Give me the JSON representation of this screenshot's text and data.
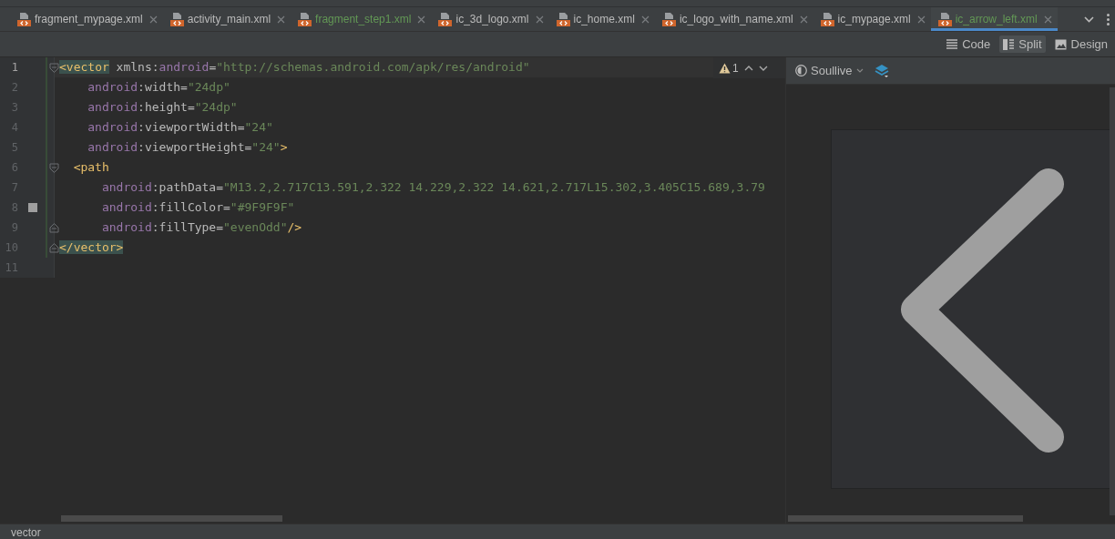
{
  "tabs": [
    {
      "label": "fragment_mypage.xml",
      "selected": false,
      "added": false
    },
    {
      "label": "activity_main.xml",
      "selected": false,
      "added": false
    },
    {
      "label": "fragment_step1.xml",
      "selected": false,
      "added": true
    },
    {
      "label": "ic_3d_logo.xml",
      "selected": false,
      "added": false
    },
    {
      "label": "ic_home.xml",
      "selected": false,
      "added": false
    },
    {
      "label": "ic_logo_with_name.xml",
      "selected": false,
      "added": false
    },
    {
      "label": "ic_mypage.xml",
      "selected": false,
      "added": false
    },
    {
      "label": "ic_arrow_left.xml",
      "selected": true,
      "added": true
    }
  ],
  "view_modes": [
    {
      "label": "Code",
      "kind": "code",
      "selected": false
    },
    {
      "label": "Split",
      "kind": "split",
      "selected": true
    },
    {
      "label": "Design",
      "kind": "design",
      "selected": false
    }
  ],
  "editor": {
    "warnings": {
      "count": "1"
    },
    "lines": [
      {
        "number": "1",
        "kind": "element",
        "current": true,
        "fold_start": true,
        "fold_end": false,
        "tokens": [
          {
            "kind": "tag",
            "text": "<vector",
            "matched": true
          },
          {
            "kind": "plain",
            "text": " xmlns:"
          },
          {
            "kind": "ns",
            "text": "android"
          },
          {
            "kind": "plain",
            "text": "="
          },
          {
            "kind": "value",
            "text": "\"http://schemas.android.com/apk/res/android\""
          }
        ]
      },
      {
        "number": "2",
        "kind": "attribute",
        "current": false,
        "fold_start": false,
        "fold_end": false,
        "tokens": [
          {
            "kind": "ns",
            "text": "android"
          },
          {
            "kind": "plain",
            "text": ":width="
          },
          {
            "kind": "value",
            "text": "\"24dp\""
          }
        ]
      },
      {
        "number": "3",
        "kind": "attribute",
        "current": false,
        "fold_start": false,
        "fold_end": false,
        "tokens": [
          {
            "kind": "ns",
            "text": "android"
          },
          {
            "kind": "plain",
            "text": ":height="
          },
          {
            "kind": "value",
            "text": "\"24dp\""
          }
        ]
      },
      {
        "number": "4",
        "kind": "attribute",
        "current": false,
        "fold_start": false,
        "fold_end": false,
        "tokens": [
          {
            "kind": "ns",
            "text": "android"
          },
          {
            "kind": "plain",
            "text": ":viewportWidth="
          },
          {
            "kind": "value",
            "text": "\"24\""
          }
        ]
      },
      {
        "number": "5",
        "kind": "attribute",
        "current": false,
        "fold_start": false,
        "fold_end": false,
        "tokens": [
          {
            "kind": "ns",
            "text": "android"
          },
          {
            "kind": "plain",
            "text": ":viewportHeight="
          },
          {
            "kind": "value",
            "text": "\"24\""
          },
          {
            "kind": "tag",
            "text": ">"
          }
        ]
      },
      {
        "number": "6",
        "kind": "child_element",
        "current": false,
        "fold_start": true,
        "fold_end": false,
        "tokens": [
          {
            "kind": "tag",
            "text": "<path"
          }
        ]
      },
      {
        "number": "7",
        "kind": "child_attribute",
        "current": false,
        "fold_start": false,
        "fold_end": false,
        "tokens": [
          {
            "kind": "ns",
            "text": "android"
          },
          {
            "kind": "plain",
            "text": ":pathData="
          },
          {
            "kind": "value",
            "text": "\"M13.2,2.717C13.591,2.322 14.229,2.322 14.621,2.717L15.302,3.405C15.689,3.79"
          }
        ]
      },
      {
        "number": "8",
        "kind": "child_attribute",
        "current": false,
        "fold_start": false,
        "fold_end": false,
        "color": "#9f9f9f",
        "tokens": [
          {
            "kind": "ns",
            "text": "android"
          },
          {
            "kind": "plain",
            "text": ":fillColor="
          },
          {
            "kind": "value",
            "text": "\"#9F9F9F\""
          }
        ]
      },
      {
        "number": "9",
        "kind": "child_attribute",
        "current": false,
        "fold_start": false,
        "fold_end": true,
        "tokens": [
          {
            "kind": "ns",
            "text": "android"
          },
          {
            "kind": "plain",
            "text": ":fillType="
          },
          {
            "kind": "value",
            "text": "\"evenOdd\""
          },
          {
            "kind": "tag",
            "text": "/>"
          }
        ]
      },
      {
        "number": "10",
        "kind": "element",
        "current": false,
        "fold_start": false,
        "fold_end": true,
        "tokens": [
          {
            "kind": "tag",
            "text": "</vector>",
            "matched": true
          }
        ]
      },
      {
        "number": "11",
        "current": false,
        "fold_start": false,
        "fold_end": false
      }
    ]
  },
  "preview": {
    "theme": "Soullive"
  },
  "status_bar": {
    "text": "vector"
  }
}
